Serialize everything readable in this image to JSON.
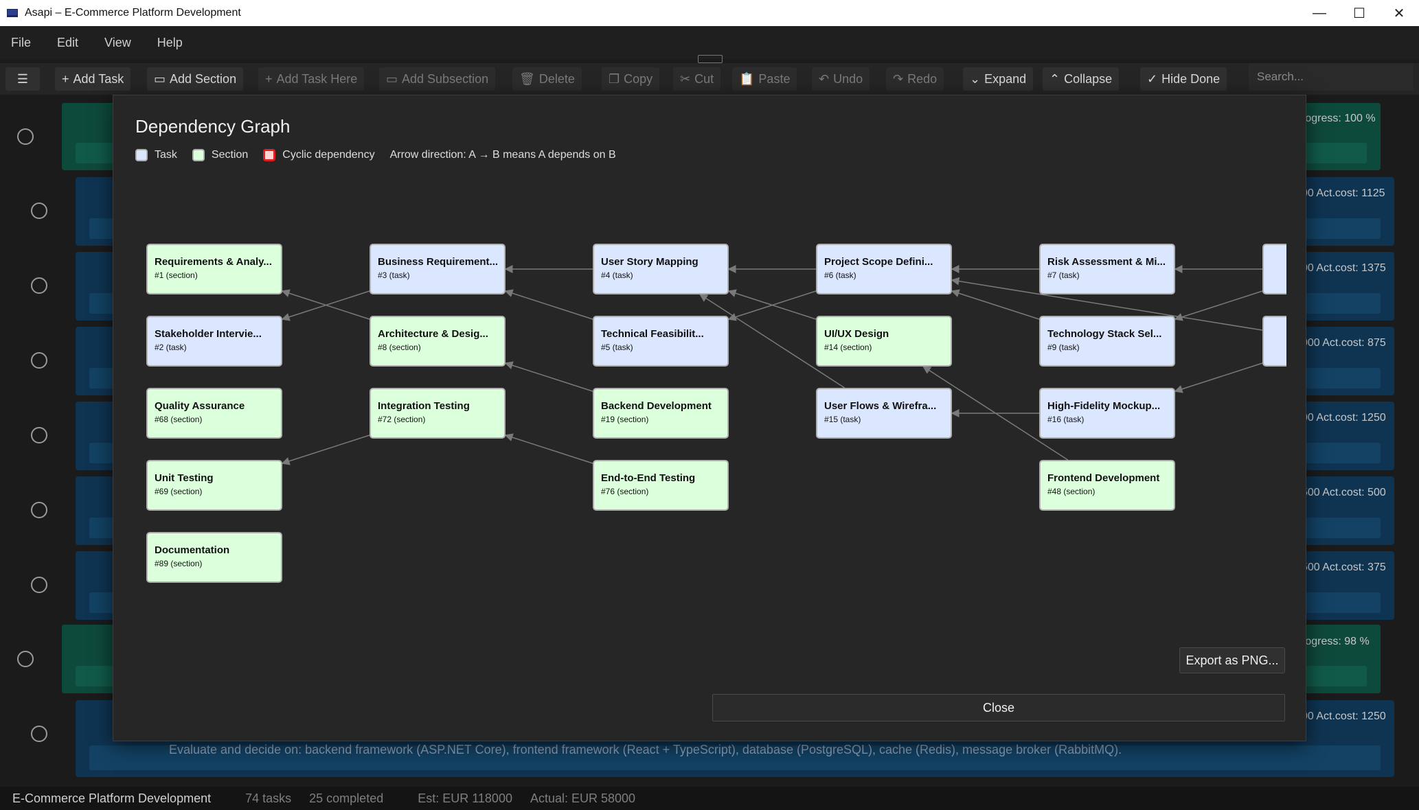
{
  "window": {
    "title": "Asapi – E-Commerce Platform Development",
    "minimize": "—",
    "maximize": "☐",
    "close": "✕"
  },
  "menu": [
    "File",
    "Edit",
    "View",
    "Help"
  ],
  "toolbar": {
    "hamburger": "☰",
    "add_task": "Add Task",
    "add_section": "Add Section",
    "add_task_here": "Add Task Here",
    "add_subsection": "Add Subsection",
    "delete": "Delete",
    "copy": "Copy",
    "cut": "Cut",
    "paste": "Paste",
    "undo": "Undo",
    "redo": "Redo",
    "expand": "Expand",
    "collapse": "Collapse",
    "hide_done": "Hide Done",
    "search_placeholder": "Search..."
  },
  "background_rows": [
    {
      "kind": "section",
      "meta": "rogress:   100   %"
    },
    {
      "kind": "task",
      "meta": "00  Act.cost:  1125"
    },
    {
      "kind": "task",
      "meta": "00  Act.cost:  1375"
    },
    {
      "kind": "task",
      "meta": "000  Act.cost:  875"
    },
    {
      "kind": "task",
      "meta": "00  Act.cost:  1250"
    },
    {
      "kind": "task",
      "meta": "500  Act.cost:  500"
    },
    {
      "kind": "task",
      "meta": "500  Act.cost:  375"
    },
    {
      "kind": "section",
      "meta": "rogress:   98   %"
    },
    {
      "kind": "task",
      "meta": "00  Act.cost:  1250"
    }
  ],
  "background_description": "Evaluate and decide on: backend framework (ASP.NET Core), frontend framework (React + TypeScript), database (PostgreSQL), cache (Redis), message broker (RabbitMQ).",
  "status_bar": {
    "project": "E-Commerce Platform Development",
    "tasks": "74 tasks",
    "completed": "25 completed",
    "estimate": "Est: EUR 118000",
    "actual": "Actual: EUR 58000"
  },
  "dialog": {
    "title": "Dependency Graph",
    "legend": {
      "task": "Task",
      "section": "Section",
      "cyclic": "Cyclic dependency",
      "arrow_note": "Arrow direction: A → B means A depends on B"
    },
    "colors": {
      "task": "#dbe6ff",
      "section": "#dcffdc",
      "cyclic": "#ffd4d4",
      "cyclic_border": "#e02020",
      "edge": "#7a7a7a"
    },
    "nodes": [
      {
        "id": 1,
        "name": "Requirements & Analy...",
        "meta": "#1  (section)",
        "kind": "section",
        "col": 0,
        "row": 0
      },
      {
        "id": 2,
        "name": "Stakeholder Intervie...",
        "meta": "#2  (task)",
        "kind": "task",
        "col": 0,
        "row": 1
      },
      {
        "id": 68,
        "name": "Quality Assurance",
        "meta": "#68  (section)",
        "kind": "section",
        "col": 0,
        "row": 2
      },
      {
        "id": 69,
        "name": "Unit Testing",
        "meta": "#69  (section)",
        "kind": "section",
        "col": 0,
        "row": 3
      },
      {
        "id": 89,
        "name": "Documentation",
        "meta": "#89  (section)",
        "kind": "section",
        "col": 0,
        "row": 4
      },
      {
        "id": 3,
        "name": "Business Requirement...",
        "meta": "#3  (task)",
        "kind": "task",
        "col": 1,
        "row": 0
      },
      {
        "id": 8,
        "name": "Architecture & Desig...",
        "meta": "#8  (section)",
        "kind": "section",
        "col": 1,
        "row": 1
      },
      {
        "id": 72,
        "name": "Integration Testing",
        "meta": "#72  (section)",
        "kind": "section",
        "col": 1,
        "row": 2
      },
      {
        "id": 4,
        "name": "User Story Mapping",
        "meta": "#4  (task)",
        "kind": "task",
        "col": 2,
        "row": 0
      },
      {
        "id": 5,
        "name": "Technical Feasibilit...",
        "meta": "#5  (task)",
        "kind": "task",
        "col": 2,
        "row": 1
      },
      {
        "id": 19,
        "name": "Backend Development",
        "meta": "#19  (section)",
        "kind": "section",
        "col": 2,
        "row": 2
      },
      {
        "id": 76,
        "name": "End-to-End Testing",
        "meta": "#76  (section)",
        "kind": "section",
        "col": 2,
        "row": 3
      },
      {
        "id": 6,
        "name": "Project Scope Defini...",
        "meta": "#6  (task)",
        "kind": "task",
        "col": 3,
        "row": 0
      },
      {
        "id": 14,
        "name": "UI/UX Design",
        "meta": "#14  (section)",
        "kind": "section",
        "col": 3,
        "row": 1
      },
      {
        "id": 15,
        "name": "User Flows & Wirefra...",
        "meta": "#15  (task)",
        "kind": "task",
        "col": 3,
        "row": 2
      },
      {
        "id": 7,
        "name": "Risk Assessment & Mi...",
        "meta": "#7  (task)",
        "kind": "task",
        "col": 4,
        "row": 0
      },
      {
        "id": 9,
        "name": "Technology Stack Sel...",
        "meta": "#9  (task)",
        "kind": "task",
        "col": 4,
        "row": 1
      },
      {
        "id": 16,
        "name": "High-Fidelity Mockup...",
        "meta": "#16  (task)",
        "kind": "task",
        "col": 4,
        "row": 2
      },
      {
        "id": 48,
        "name": "Frontend Development",
        "meta": "#48  (section)",
        "kind": "section",
        "col": 4,
        "row": 3
      },
      {
        "id": "x1",
        "name": "",
        "meta": "",
        "kind": "task",
        "col": 5,
        "row": 0
      },
      {
        "id": "x2",
        "name": "",
        "meta": "",
        "kind": "task",
        "col": 5,
        "row": 1
      }
    ],
    "edges": [
      [
        4,
        3
      ],
      [
        6,
        4
      ],
      [
        7,
        6
      ],
      [
        6,
        5
      ],
      [
        14,
        4
      ],
      [
        15,
        4
      ],
      [
        8,
        1
      ],
      [
        3,
        2
      ],
      [
        5,
        3
      ],
      [
        19,
        8
      ],
      [
        16,
        15
      ],
      [
        48,
        14
      ],
      [
        9,
        6
      ],
      [
        72,
        69
      ],
      [
        76,
        72
      ],
      [
        "x1",
        7
      ],
      [
        "x1",
        9
      ],
      [
        "x2",
        16
      ],
      [
        "x2",
        6
      ]
    ],
    "export_button": "Export as PNG...",
    "close_button": "Close"
  }
}
